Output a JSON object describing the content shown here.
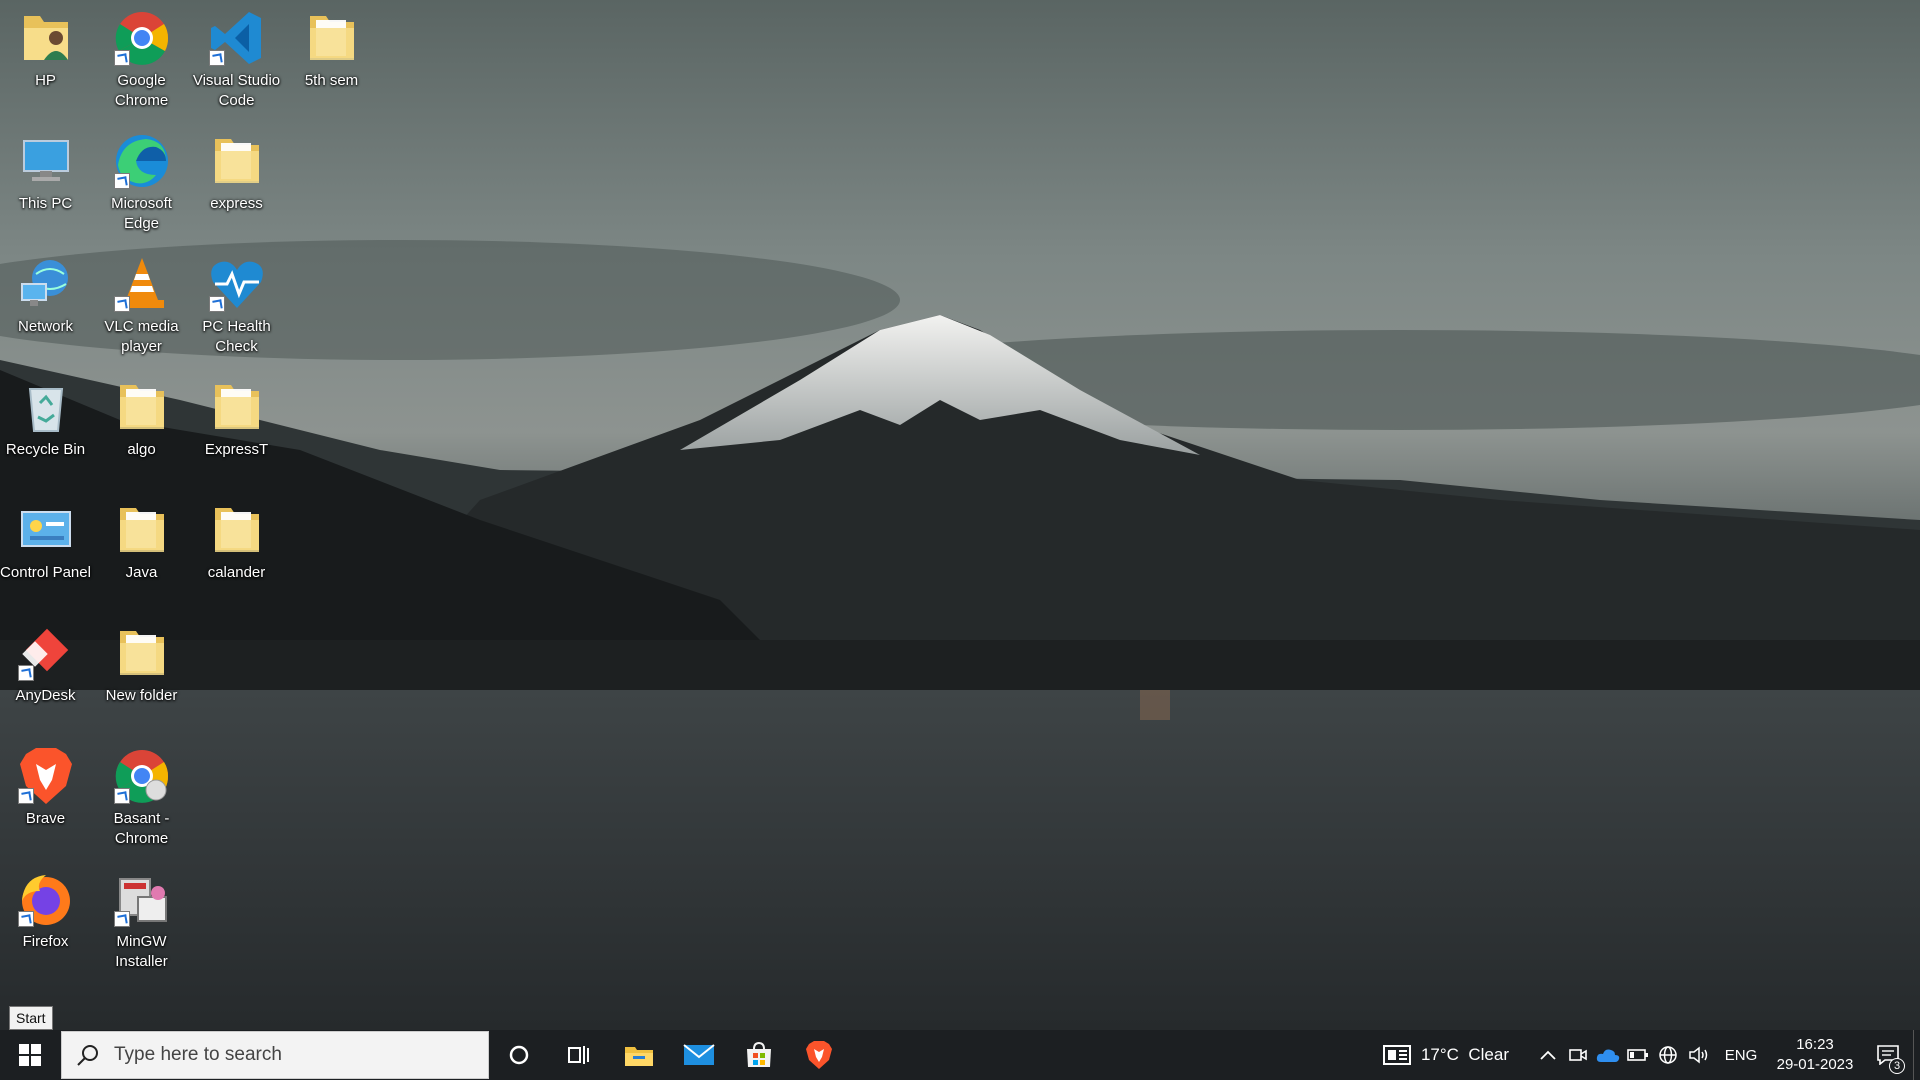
{
  "desktop_icons": [
    {
      "label": "HP",
      "icon": "user-folder-icon"
    },
    {
      "label": "Google Chrome",
      "icon": "chrome-icon"
    },
    {
      "label": "Visual Studio Code",
      "icon": "vscode-icon"
    },
    {
      "label": "5th sem",
      "icon": "folder-icon"
    },
    {
      "label": "This PC",
      "icon": "computer-icon"
    },
    {
      "label": "Microsoft Edge",
      "icon": "edge-icon"
    },
    {
      "label": "express",
      "icon": "folder-icon"
    },
    {
      "label": "Network",
      "icon": "network-icon"
    },
    {
      "label": "VLC media player",
      "icon": "vlc-icon"
    },
    {
      "label": "PC Health Check",
      "icon": "health-check-icon"
    },
    {
      "label": "Recycle Bin",
      "icon": "recycle-bin-icon"
    },
    {
      "label": "algo",
      "icon": "folder-icon"
    },
    {
      "label": "ExpressT",
      "icon": "folder-icon"
    },
    {
      "label": "Control Panel",
      "icon": "control-panel-icon"
    },
    {
      "label": "Java",
      "icon": "folder-icon"
    },
    {
      "label": "calander",
      "icon": "folder-icon"
    },
    {
      "label": "AnyDesk",
      "icon": "anydesk-icon"
    },
    {
      "label": "New folder",
      "icon": "folder-icon"
    },
    {
      "label": "Brave",
      "icon": "brave-icon"
    },
    {
      "label": "Basant - Chrome",
      "icon": "chrome-profile-icon"
    },
    {
      "label": "Firefox",
      "icon": "firefox-icon"
    },
    {
      "label": "MinGW Installer",
      "icon": "mingw-installer-icon"
    }
  ],
  "tooltip": {
    "start": "Start"
  },
  "taskbar": {
    "search_placeholder": "Type here to search",
    "weather": "17°C  Clear",
    "language": "ENG",
    "time": "16:23",
    "date": "29-01-2023",
    "notification_count": "3"
  },
  "colors": {
    "taskbar_bg": "#1c1f22",
    "accent_blue": "#1e90ff"
  }
}
